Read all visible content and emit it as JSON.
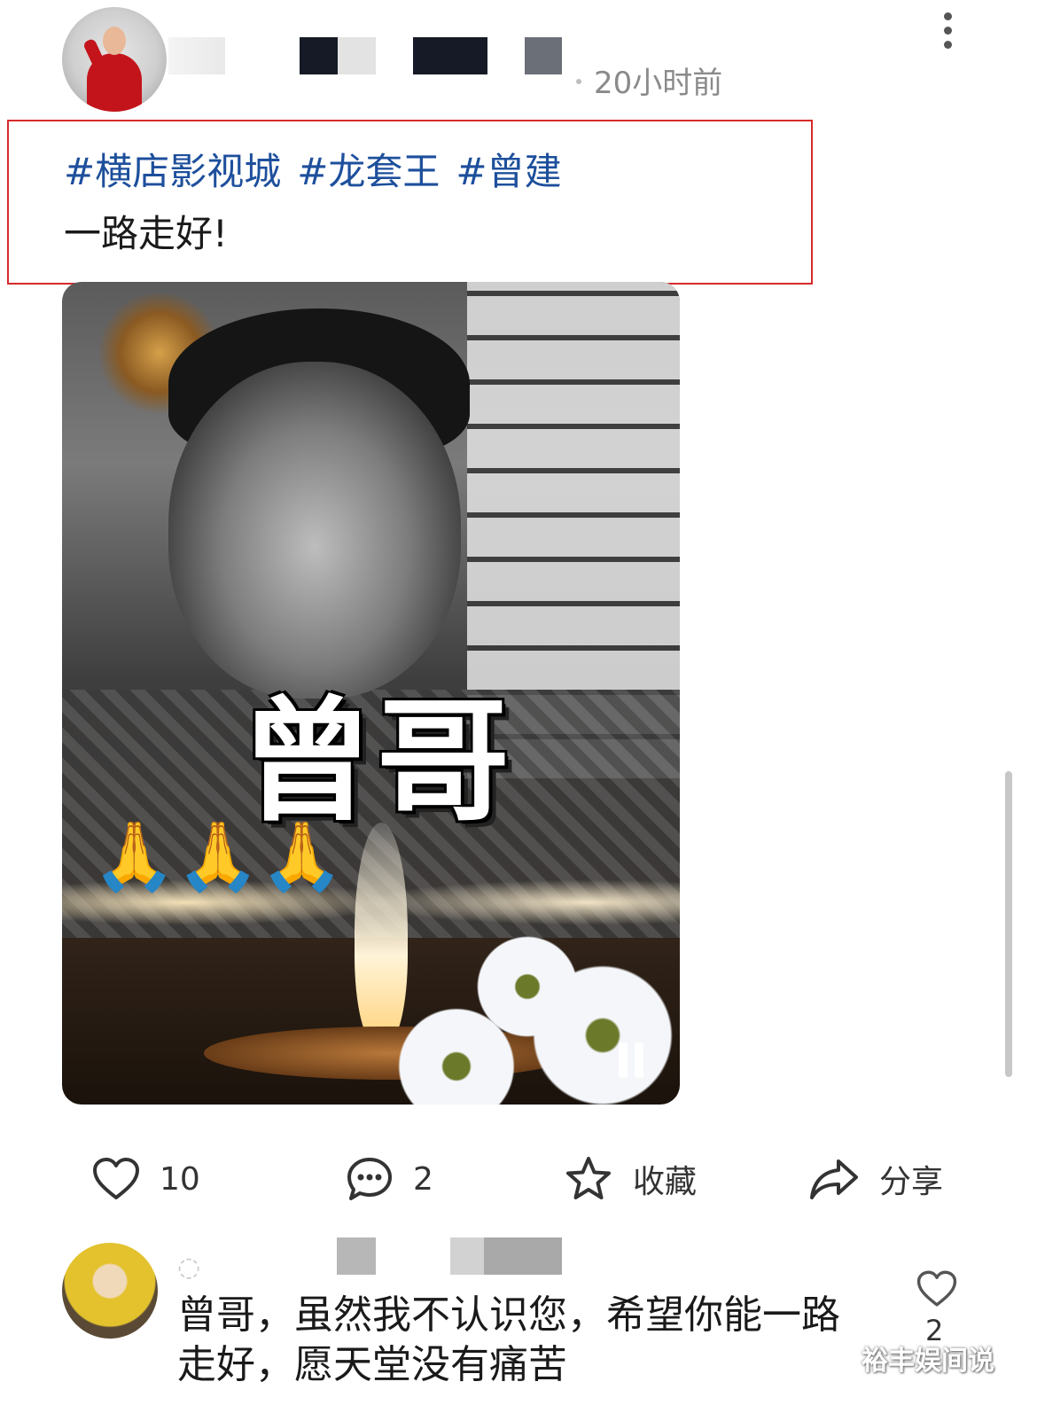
{
  "post": {
    "timestamp": "20小时前",
    "hashtags": [
      "#横店影视城",
      "#龙套王",
      "#曾建"
    ],
    "caption": "一路走好!"
  },
  "video": {
    "overlay_text": "曾哥",
    "emoji": "🙏🙏🙏",
    "state": "playing"
  },
  "actions": {
    "like_count": "10",
    "comment_count": "2",
    "favorite_label": "收藏",
    "share_label": "分享"
  },
  "comment": {
    "text": "曾哥，虽然我不认识您，希望你能一路走好，愿天堂没有痛苦",
    "like_count": "2"
  },
  "watermark": "裕丰娱间说",
  "colors": {
    "hashtag": "#1d4f9c",
    "highlight_box": "#d52a2a",
    "icon": "#333333"
  },
  "icons": [
    "more-vertical-icon",
    "heart-icon",
    "comment-icon",
    "star-icon",
    "share-icon",
    "pause-icon"
  ]
}
